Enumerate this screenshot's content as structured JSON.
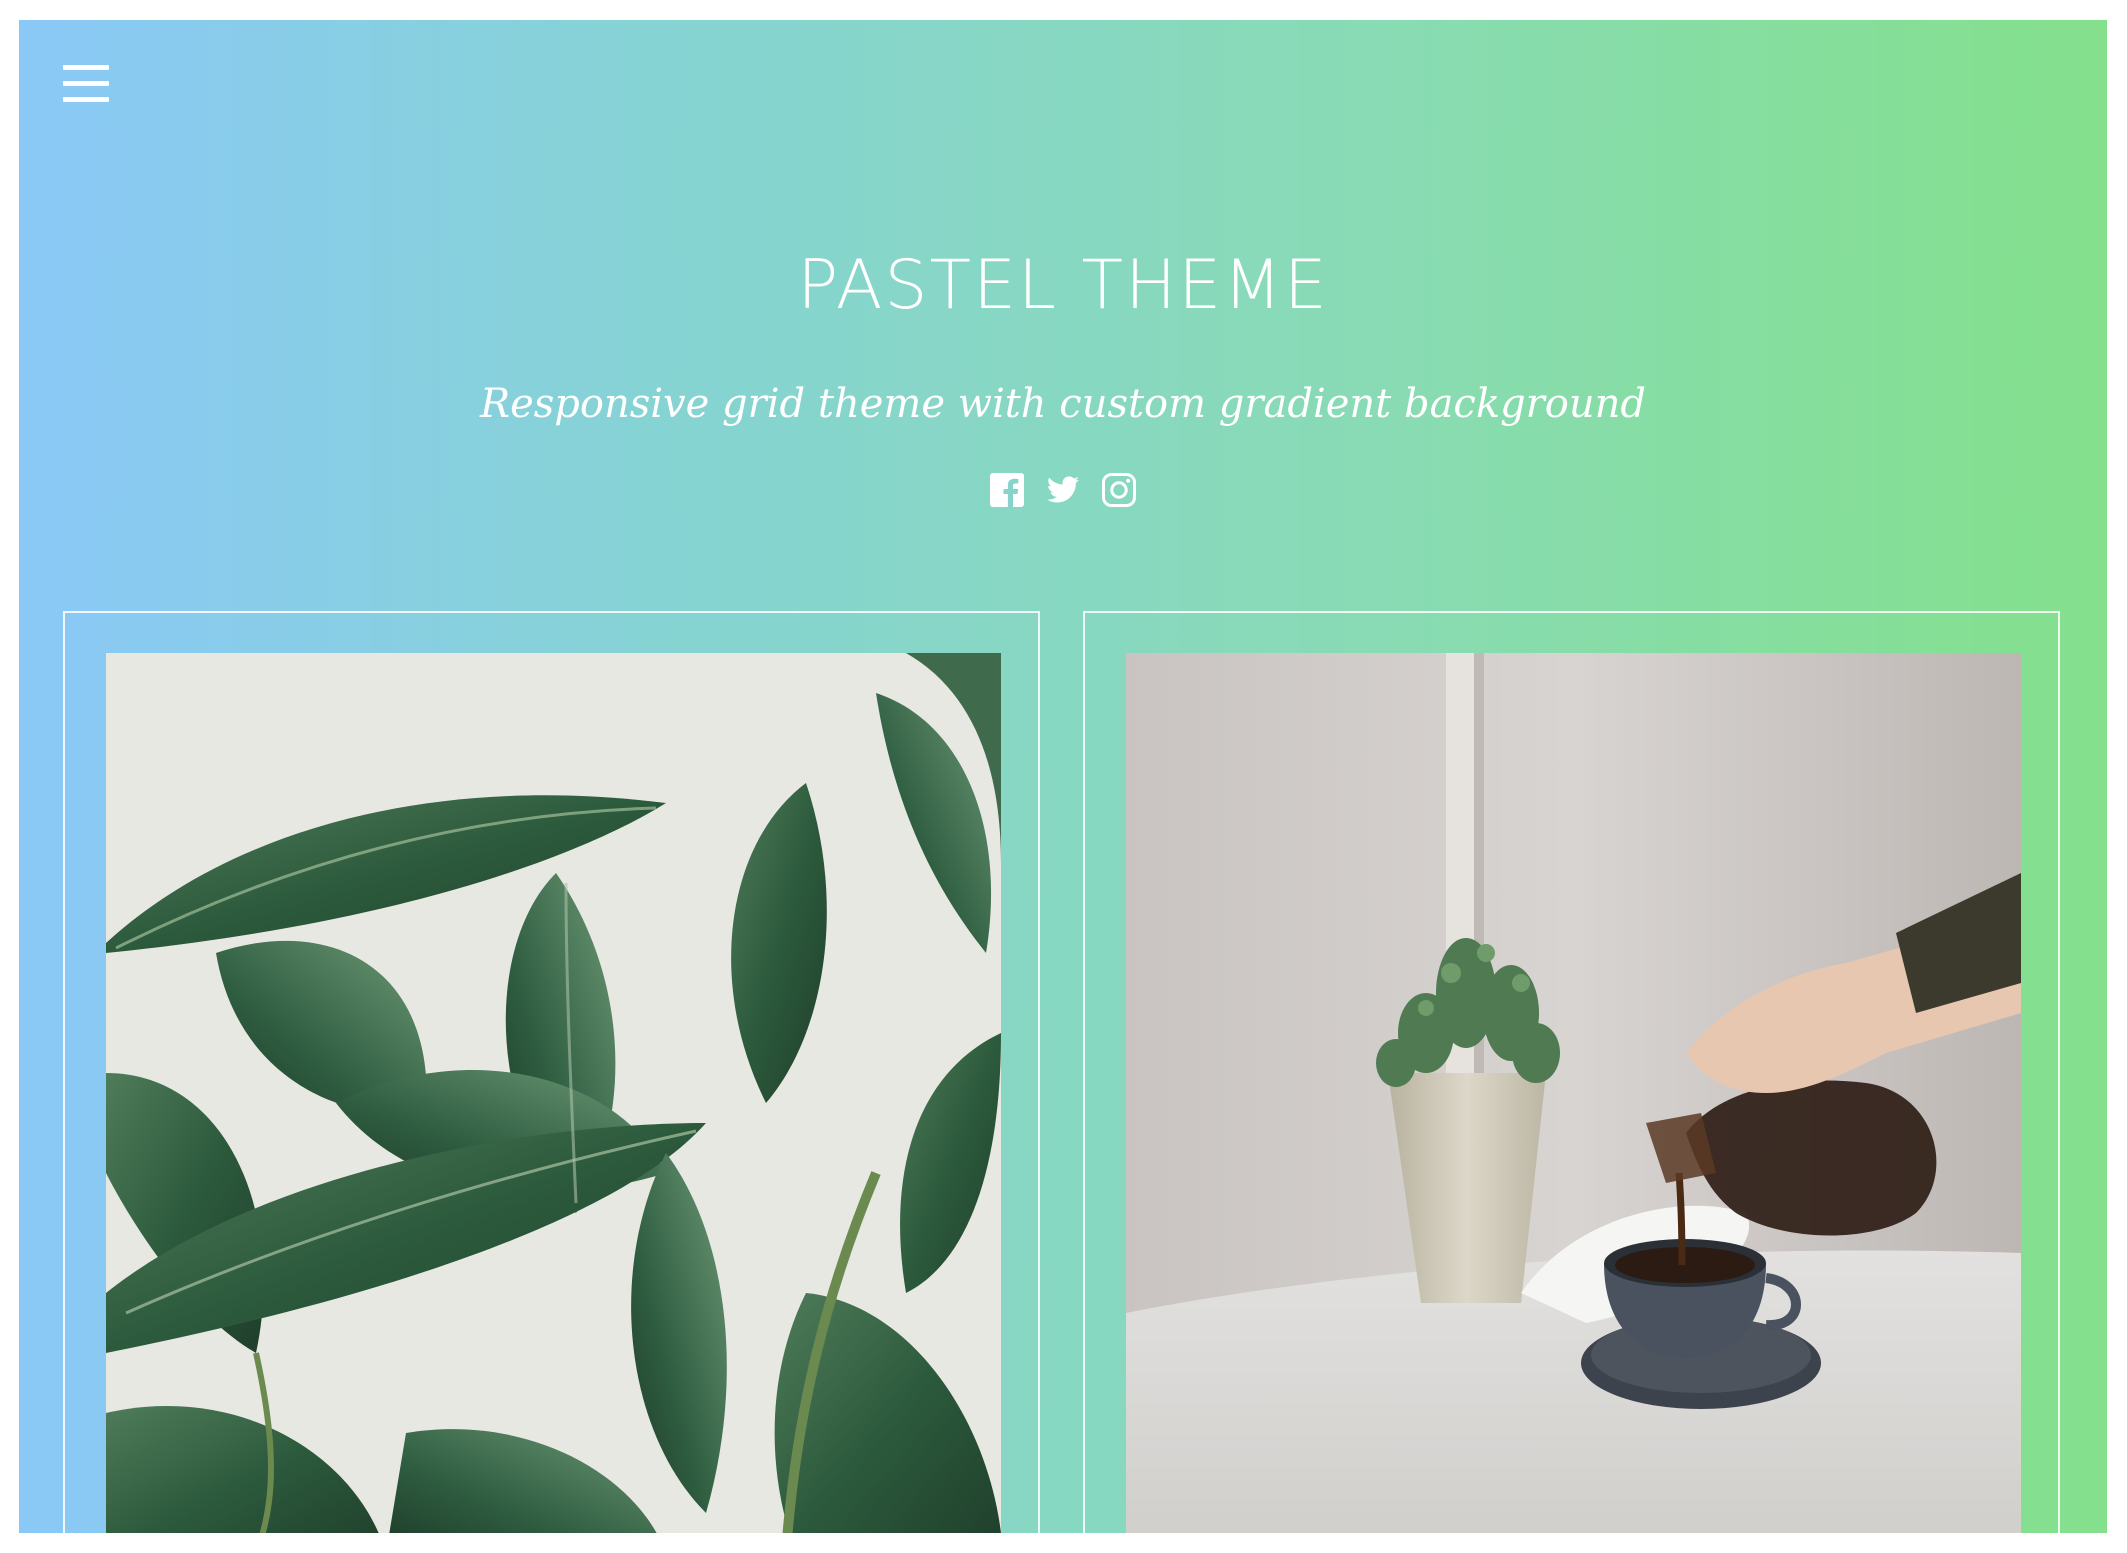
{
  "header": {
    "menu_icon": "hamburger-menu-icon",
    "title": "PASTEL THEME",
    "tagline": "Responsive grid theme with custom gradient background",
    "social": [
      {
        "name": "facebook",
        "icon": "facebook-icon"
      },
      {
        "name": "twitter",
        "icon": "twitter-icon"
      },
      {
        "name": "instagram",
        "icon": "instagram-icon"
      }
    ]
  },
  "colors": {
    "gradient_start": "#8ac8f7",
    "gradient_end": "#84e08c",
    "text": "#ffffff"
  },
  "grid": {
    "posts": [
      {
        "image": "rubber plant leaves"
      },
      {
        "image": "coffee pouring beside succulent"
      }
    ]
  }
}
